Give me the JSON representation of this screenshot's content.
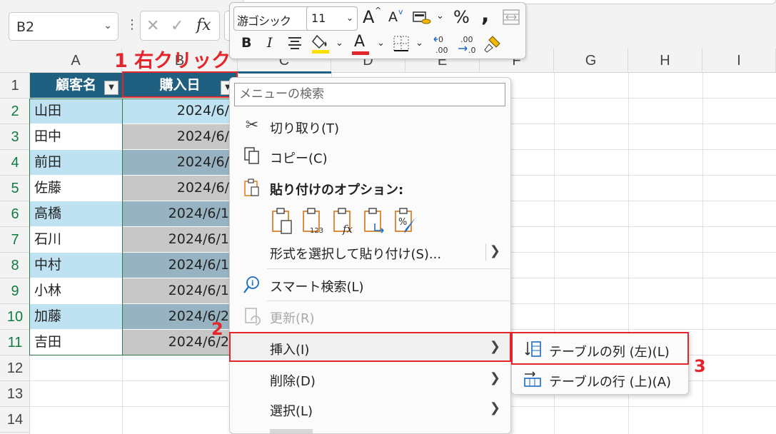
{
  "name_box": {
    "value": "B2"
  },
  "formula_bar": {
    "fx_label": "fx"
  },
  "mini_toolbar": {
    "font_name": "游ゴシック",
    "font_size": "11",
    "bold_label": "B",
    "italic_label": "I",
    "percent_label": "%",
    "comma_label": ",",
    "increase_font_label": "A",
    "decrease_font_label": "A",
    "font_color_label": "A",
    "highlight_color": "#ffe000",
    "font_color": "#e3262b"
  },
  "columns": [
    "A",
    "B",
    "C",
    "D",
    "E",
    "F",
    "G",
    "H",
    "I"
  ],
  "rows": [
    "1",
    "2",
    "3",
    "4",
    "5",
    "6",
    "7",
    "8",
    "9",
    "10",
    "11",
    "12",
    "13",
    "14"
  ],
  "table": {
    "header_a": "顧客名",
    "header_b": "購入日",
    "names": [
      "山田",
      "田中",
      "前田",
      "佐藤",
      "高橋",
      "石川",
      "中村",
      "小林",
      "加藤",
      "吉田"
    ],
    "dates": [
      "2024/6/",
      "2024/6/",
      "2024/6/",
      "2024/6/",
      "2024/6/1",
      "2024/6/1",
      "2024/6/1",
      "2024/6/1",
      "2024/6/2",
      "2024/6/2"
    ]
  },
  "annotations": {
    "step1": "1 右クリック",
    "step2": "2",
    "step3": "3",
    "color": "#e3262b"
  },
  "context_menu": {
    "search_placeholder": "メニューの検索",
    "cut": "切り取り(T)",
    "copy": "コピー(C)",
    "paste_options": "貼り付けのオプション:",
    "paste_special": "形式を選択して貼り付け(S)...",
    "smart_lookup": "スマート検索(L)",
    "refresh": "更新(R)",
    "insert": "挿入(I)",
    "delete": "削除(D)",
    "select": "選択(L)"
  },
  "submenu": {
    "insert_columns_left": "テーブルの列 (左)(L)",
    "insert_rows_above": "テーブルの行 (上)(A)"
  }
}
